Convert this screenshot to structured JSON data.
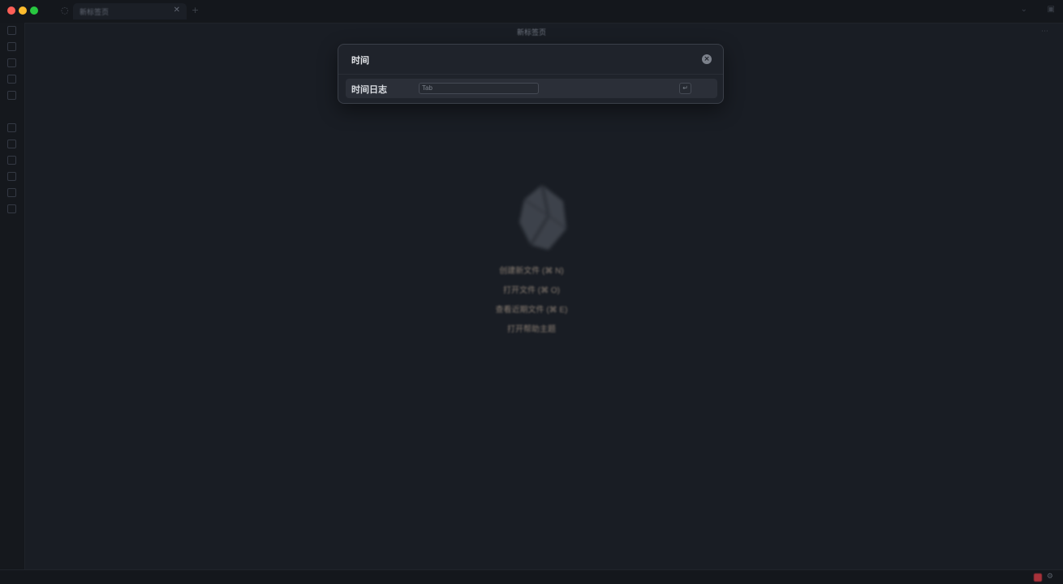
{
  "titlebar": {
    "tab_title": "新标签页",
    "tab_close": "✕",
    "new_tab": "+"
  },
  "header": {
    "title": "新标签页"
  },
  "palette": {
    "query": "时间",
    "clear_icon": "clear-circle-icon",
    "suggestions": [
      {
        "label": "时间日志",
        "keys": [
          "↵",
          "Tab"
        ]
      }
    ]
  },
  "empty_state": {
    "actions": [
      "创建新文件 (⌘ N)",
      "打开文件 (⌘ O)",
      "查看近期文件 (⌘ E)",
      "打开帮助主题"
    ]
  },
  "colors": {
    "background": "#191d24",
    "palette_bg": "#1f232b",
    "selection_bg": "#2b2f38",
    "text_primary": "#e6e8ec",
    "muted_action": "#8a7e73"
  }
}
